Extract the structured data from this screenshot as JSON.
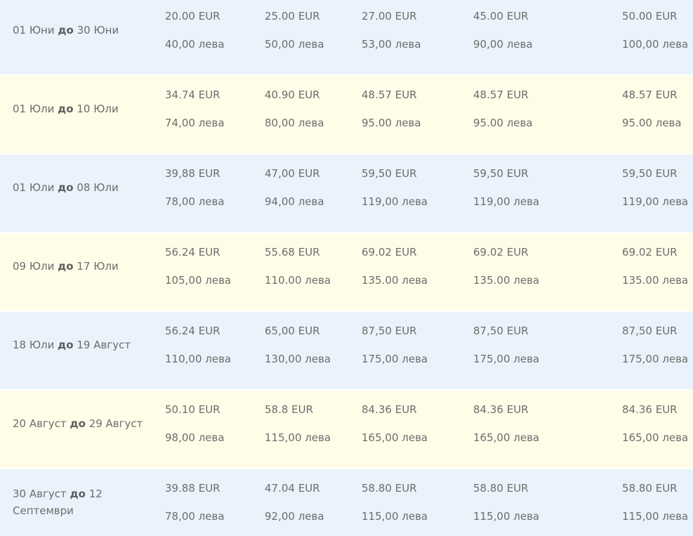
{
  "connector": "до",
  "rows": [
    {
      "from": "01 Юни",
      "to": "30 Юни",
      "eur": [
        "20.00 EUR",
        "25.00 EUR",
        "27.00 EUR",
        "45.00 EUR",
        "50.00 EUR"
      ],
      "lev": [
        "40,00 лева",
        "50,00 лева",
        "53,00 лева",
        "90,00 лева",
        "100,00 лева"
      ]
    },
    {
      "from": "01 Юли",
      "to": "10 Юли",
      "eur": [
        "34.74 EUR",
        "40.90 EUR",
        "48.57 EUR",
        "48.57 EUR",
        "48.57 EUR"
      ],
      "lev": [
        "74,00 лева",
        "80,00 лева",
        "95.00 лева",
        "95.00 лева",
        "95.00 лева"
      ]
    },
    {
      "from": "01 Юли",
      "to": "08 Юли",
      "eur": [
        "39,88 EUR",
        "47,00 EUR",
        "59,50 EUR",
        "59,50 EUR",
        "59,50 EUR"
      ],
      "lev": [
        "78,00 лева",
        "94,00 лева",
        "119,00 лева",
        "119,00 лева",
        "119,00 лева"
      ]
    },
    {
      "from": "09 Юли",
      "to": "17 Юли",
      "eur": [
        "56.24 EUR",
        "55.68 EUR",
        "69.02 EUR",
        "69.02 EUR",
        "69.02 EUR"
      ],
      "lev": [
        "105,00 лева",
        "110.00 лева",
        "135.00 лева",
        "135.00 лева",
        "135.00 лева"
      ]
    },
    {
      "from": "18 Юли",
      "to": "19 Август",
      "eur": [
        "56.24 EUR",
        "65,00 EUR",
        "87,50 EUR",
        "87,50 EUR",
        "87,50 EUR"
      ],
      "lev": [
        "110,00 лева",
        "130,00 лева",
        "175,00 лева",
        "175,00 лева",
        "175,00 лева"
      ]
    },
    {
      "from": "20 Август",
      "to": "29 Август",
      "eur": [
        "50.10 EUR",
        "58.8 EUR",
        "84.36 EUR",
        "84.36 EUR",
        "84.36 EUR"
      ],
      "lev": [
        "98,00 лева",
        "115,00 лева",
        "165,00 лева",
        "165,00 лева",
        "165,00 лева"
      ]
    },
    {
      "from": "30 Август",
      "to": "12 Септември",
      "eur": [
        "39.88 EUR",
        "47.04 EUR",
        "58.80 EUR",
        "58.80 EUR",
        "58.80 EUR"
      ],
      "lev": [
        "78,00 лева",
        "92,00 лева",
        "115,00 лева",
        "115,00 лева",
        "115,00 лева"
      ]
    }
  ],
  "colors": {
    "row_blue": "#eaf3fb",
    "row_yellow": "#fffde8",
    "text": "#6d6d6d"
  }
}
